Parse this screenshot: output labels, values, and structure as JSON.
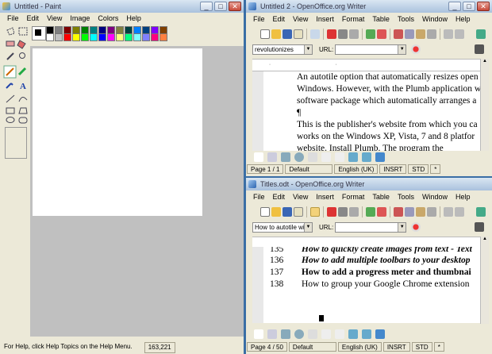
{
  "paint": {
    "title": "Untitled - Paint",
    "menu": [
      "File",
      "Edit",
      "View",
      "Image",
      "Colors",
      "Help"
    ],
    "status_help": "For Help, click Help Topics on the Help Menu.",
    "status_coords": "163,221",
    "palette_top": [
      "#000000",
      "#808080",
      "#800000",
      "#808000",
      "#008000",
      "#008080",
      "#000080",
      "#800080",
      "#808040",
      "#004040",
      "#0080ff",
      "#004080",
      "#8000ff",
      "#804000"
    ],
    "palette_bottom": [
      "#ffffff",
      "#c0c0c0",
      "#ff0000",
      "#ffff00",
      "#00ff00",
      "#00ffff",
      "#0000ff",
      "#ff00ff",
      "#ffff80",
      "#00ff80",
      "#80ffff",
      "#8080ff",
      "#ff0080",
      "#ff8040"
    ]
  },
  "writer1": {
    "title": "Untitled 2 - OpenOffice.org Writer",
    "menu": [
      "File",
      "Edit",
      "View",
      "Insert",
      "Format",
      "Table",
      "Tools",
      "Window",
      "Help"
    ],
    "find_value": "revolutionizes",
    "url_label": "URL:",
    "lines": [
      "An autotile option that automatically resizes open",
      "Windows. However, with the Plumb application w",
      "software package which automatically arranges a",
      "¶",
      "This is the publisher's website from which you ca",
      "works on the Windows XP, Vista, 7 and 8 platfor",
      "website. Install Plumb. The program the"
    ],
    "status": [
      "Page 1 / 1",
      "Default",
      "English (UK)",
      "INSRT",
      "STD",
      "*"
    ]
  },
  "writer2": {
    "title": "Titles.odt - OpenOffice.org Writer",
    "menu": [
      "File",
      "Edit",
      "View",
      "Insert",
      "Format",
      "Table",
      "Tools",
      "Window",
      "Help"
    ],
    "find_value": "How to autotile windo",
    "url_label": "URL:",
    "rows": [
      {
        "num": "135",
        "text": "How to quickly create images from text - Text"
      },
      {
        "num": "136",
        "text": "How to add multiple toolbars to your desktop"
      },
      {
        "num": "137",
        "text": "How to add a progress meter and thumbnai"
      },
      {
        "num": "138",
        "text": "How to group your Google Chrome extension"
      }
    ],
    "status": [
      "Page 4 / 50",
      "Default",
      "English (UK)",
      "INSRT",
      "STD",
      "*"
    ]
  }
}
